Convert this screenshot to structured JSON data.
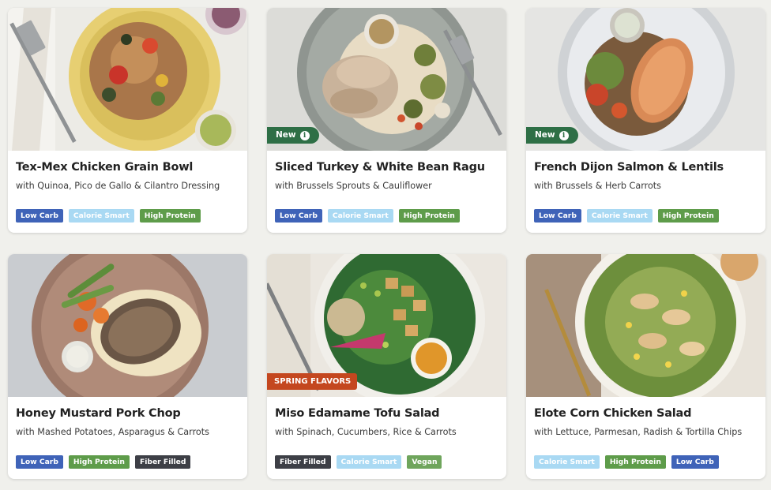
{
  "meals": [
    {
      "title": "Tex-Mex Chicken Grain Bowl",
      "subtitle": "with Quinoa, Pico de Gallo & Cilantro Dressing",
      "badge": null,
      "tags": [
        {
          "label": "Low Carb",
          "kind": "lowcarb"
        },
        {
          "label": "Calorie Smart",
          "kind": "calorie"
        },
        {
          "label": "High Protein",
          "kind": "protein"
        }
      ]
    },
    {
      "title": "Sliced Turkey & White Bean Ragu",
      "subtitle": "with Brussels Sprouts & Cauliflower",
      "badge": {
        "label": "New",
        "style": "new"
      },
      "tags": [
        {
          "label": "Low Carb",
          "kind": "lowcarb"
        },
        {
          "label": "Calorie Smart",
          "kind": "calorie"
        },
        {
          "label": "High Protein",
          "kind": "protein"
        }
      ]
    },
    {
      "title": "French Dijon Salmon & Lentils",
      "subtitle": "with Brussels & Herb Carrots",
      "badge": {
        "label": "New",
        "style": "new"
      },
      "tags": [
        {
          "label": "Low Carb",
          "kind": "lowcarb"
        },
        {
          "label": "Calorie Smart",
          "kind": "calorie"
        },
        {
          "label": "High Protein",
          "kind": "protein"
        }
      ]
    },
    {
      "title": "Honey Mustard Pork Chop",
      "subtitle": "with Mashed Potatoes, Asparagus & Carrots",
      "badge": null,
      "tags": [
        {
          "label": "Low Carb",
          "kind": "lowcarb"
        },
        {
          "label": "High Protein",
          "kind": "protein"
        },
        {
          "label": "Fiber Filled",
          "kind": "fiber"
        }
      ]
    },
    {
      "title": "Miso Edamame Tofu Salad",
      "subtitle": "with Spinach, Cucumbers, Rice & Carrots",
      "badge": {
        "label": "SPRING FLAVORS",
        "style": "spring"
      },
      "tags": [
        {
          "label": "Fiber Filled",
          "kind": "fiber"
        },
        {
          "label": "Calorie Smart",
          "kind": "calorie"
        },
        {
          "label": "Vegan",
          "kind": "vegan"
        }
      ]
    },
    {
      "title": "Elote Corn Chicken Salad",
      "subtitle": "with Lettuce, Parmesan, Radish & Tortilla Chips",
      "badge": null,
      "tags": [
        {
          "label": "Calorie Smart",
          "kind": "calorie"
        },
        {
          "label": "High Protein",
          "kind": "protein"
        },
        {
          "label": "Low Carb",
          "kind": "lowcarb"
        }
      ]
    }
  ],
  "colors": {
    "page_background": "#f0f0ec",
    "new_badge": "#2e6f46",
    "spring_badge": "#c4471f",
    "low_carb": "#3f63b8",
    "calorie_smart": "#a9d9f3",
    "high_protein": "#5e9c4a",
    "fiber_filled": "#3d3f46",
    "vegan": "#6fa55c"
  },
  "icons": {
    "badge_info": "info-icon"
  }
}
